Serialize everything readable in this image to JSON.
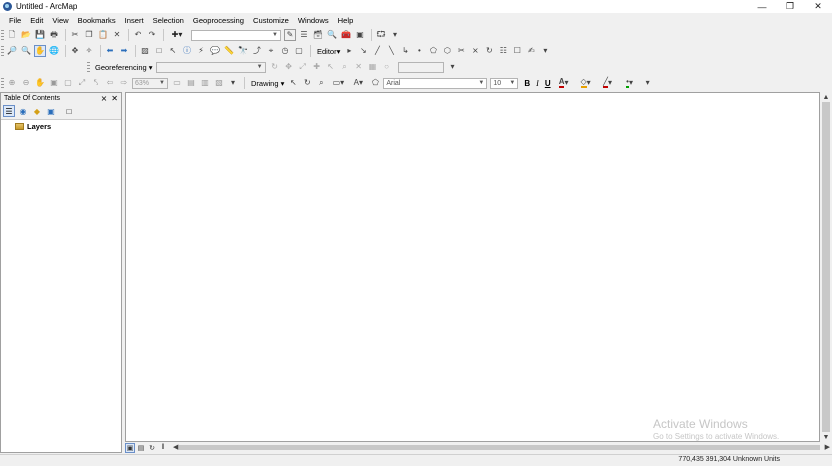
{
  "window": {
    "title": "Untitled - ArcMap",
    "minimize": "—",
    "restore": "❐",
    "close": "✕"
  },
  "menu": [
    "File",
    "Edit",
    "View",
    "Bookmarks",
    "Insert",
    "Selection",
    "Geoprocessing",
    "Customize",
    "Windows",
    "Help"
  ],
  "toolbar": {
    "editor_label": "Editor▾",
    "georeferencing_label": "Georeferencing ▾",
    "drawing_label": "Drawing ▾",
    "zoom_value": "63%",
    "font_name": "Arial",
    "font_size": "10",
    "bold": "B",
    "italic": "I",
    "underline": "U",
    "text_color_glyph": "A",
    "text_color": "#c00000",
    "fill_color": "#e8a000",
    "line_color": "#c00000",
    "marker_color": "#00a000"
  },
  "toc": {
    "title": "Table Of Contents",
    "pin": "⨯",
    "close": "✕",
    "layers_label": "Layers"
  },
  "watermark": {
    "line1": "Activate Windows",
    "line2": "Go to Settings to activate Windows."
  },
  "status": {
    "coordinates": "770,435  391,304 Unknown Units"
  }
}
